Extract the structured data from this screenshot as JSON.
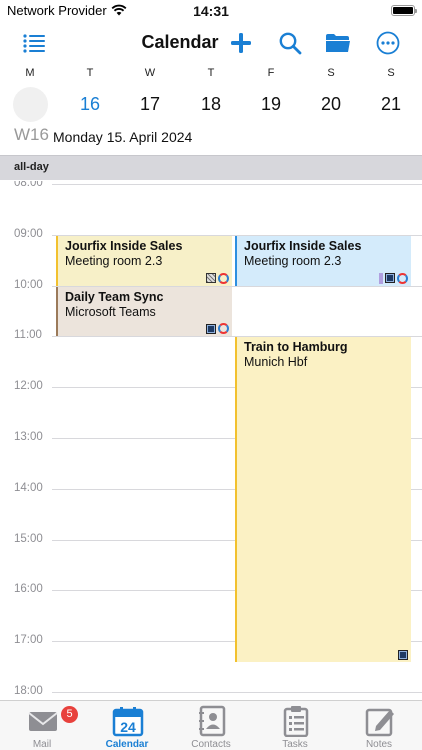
{
  "status_bar": {
    "carrier": "Network Provider",
    "time": "14:31",
    "icons": [
      "wifi-icon",
      "battery-icon"
    ]
  },
  "nav_bar": {
    "title": "Calendar",
    "buttons": [
      "list-icon",
      "add-icon",
      "search-icon",
      "folder-icon",
      "more-icon"
    ],
    "accent": "#1a7fd4"
  },
  "week": {
    "weekdays": [
      "M",
      "T",
      "W",
      "T",
      "F",
      "S",
      "S"
    ],
    "day_numbers": [
      "",
      "16",
      "17",
      "18",
      "19",
      "20",
      "21"
    ],
    "today_index": 1,
    "week_number": "W16",
    "date_label": "Monday  15. April 2024"
  },
  "all_day_label": "all-day",
  "hours": [
    "08:00",
    "09:00",
    "10:00",
    "11:00",
    "12:00",
    "13:00",
    "14:00",
    "15:00",
    "16:00",
    "17:00",
    "18:00"
  ],
  "events": [
    {
      "title": "Jourfix Inside Sales",
      "subtitle": "Meeting room 2.3",
      "start": "09:00",
      "end": "10:00",
      "column": "left",
      "color": "#f7f0c8",
      "bar": "#f2c12e",
      "icons": [
        "grid-icon",
        "sync-icon"
      ]
    },
    {
      "title": "Jourfix Inside Sales",
      "subtitle": "Meeting room 2.3",
      "start": "09:00",
      "end": "10:00",
      "column": "right",
      "color": "#d4ebfb",
      "bar": "#2d8fe0",
      "icons": [
        "stripe-icon",
        "solid-icon",
        "sync-icon"
      ]
    },
    {
      "title": "Daily Team Sync",
      "subtitle": "Microsoft Teams",
      "start": "10:00",
      "end": "11:00",
      "column": "left",
      "color": "#ece4dc",
      "bar": "#9b7a5a",
      "icons": [
        "solid-icon",
        "sync-icon"
      ]
    },
    {
      "title": "Train to Hamburg",
      "subtitle": "Munich Hbf",
      "start": "11:00",
      "end": "17:25",
      "column": "right",
      "color": "#fbf1c4",
      "bar": "#f2c12e",
      "icons": [
        "solid-icon"
      ]
    }
  ],
  "tabs": [
    {
      "label": "Mail",
      "icon": "mail-icon",
      "badge": "5",
      "active": false
    },
    {
      "label": "Calendar",
      "icon": "calendar-icon",
      "date": "24",
      "active": true
    },
    {
      "label": "Contacts",
      "icon": "contacts-icon",
      "active": false
    },
    {
      "label": "Tasks",
      "icon": "tasks-icon",
      "active": false
    },
    {
      "label": "Notes",
      "icon": "notes-icon",
      "active": false
    }
  ]
}
